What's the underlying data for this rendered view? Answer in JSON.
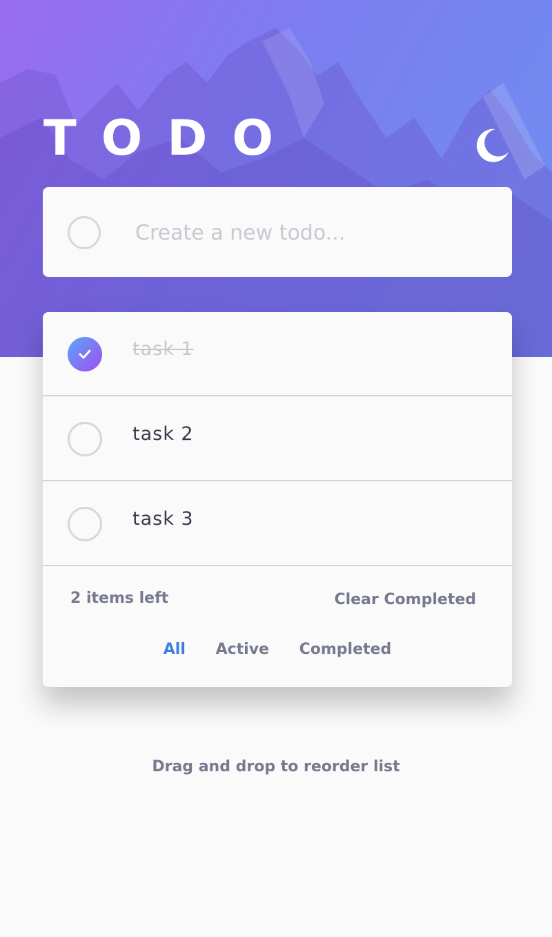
{
  "header": {
    "title": "TODO",
    "theme_icon": "moon-icon"
  },
  "new_todo": {
    "placeholder": "Create a new todo...",
    "value": ""
  },
  "todos": [
    {
      "text": "task 1",
      "completed": true
    },
    {
      "text": "task 2",
      "completed": false
    },
    {
      "text": "task 3",
      "completed": false
    }
  ],
  "footer": {
    "items_left": "2 items left",
    "clear_label": "Clear Completed",
    "filters": [
      {
        "label": "All",
        "active": true
      },
      {
        "label": "Active",
        "active": false
      },
      {
        "label": "Completed",
        "active": false
      }
    ]
  },
  "hint": "Drag and drop to reorder list",
  "colors": {
    "accent": "#3b7ce6",
    "check_gradient_start": "#5aa8f8",
    "check_gradient_end": "#a04cf0",
    "hero_start": "#9a6cf0",
    "hero_end": "#6f8ff0"
  }
}
